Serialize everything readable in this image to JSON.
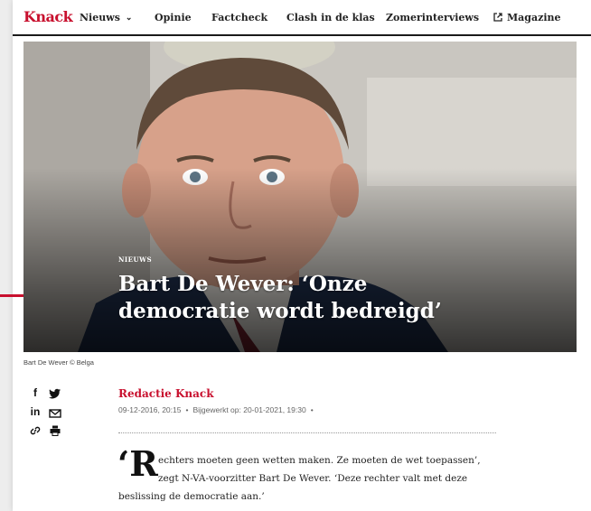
{
  "nav": {
    "logo": "Knack",
    "items": [
      "Nieuws",
      "Opinie",
      "Factcheck",
      "Clash in de klas",
      "Zomerinterviews",
      "Magazine"
    ]
  },
  "hero": {
    "kicker": "NIEUWS",
    "title_line1": "Bart De Wever: ‘Onze",
    "title_line2": "democratie wordt bedreigd’"
  },
  "caption": "Bart De Wever © Belga",
  "share": {
    "icons": [
      "facebook-icon",
      "twitter-icon",
      "linkedin-icon",
      "mail-icon",
      "link-icon",
      "print-icon"
    ]
  },
  "article": {
    "author": "Redactie Knack",
    "date": "09-12-2016, 20:15",
    "updated": "Bijgewerkt op: 20-01-2021, 19:30",
    "dropcap": "‘R",
    "lead_line1": "echters moeten geen wetten maken. Ze moeten de wet toepassen’,",
    "lead_line2": "zegt N-VA-voorzitter Bart De Wever. ‘Deze rechter valt met deze",
    "lead_line3": "beslissing de democratie aan.’"
  },
  "colors": {
    "brand": "#c8102e",
    "text": "#222222",
    "background": "#ededed"
  }
}
